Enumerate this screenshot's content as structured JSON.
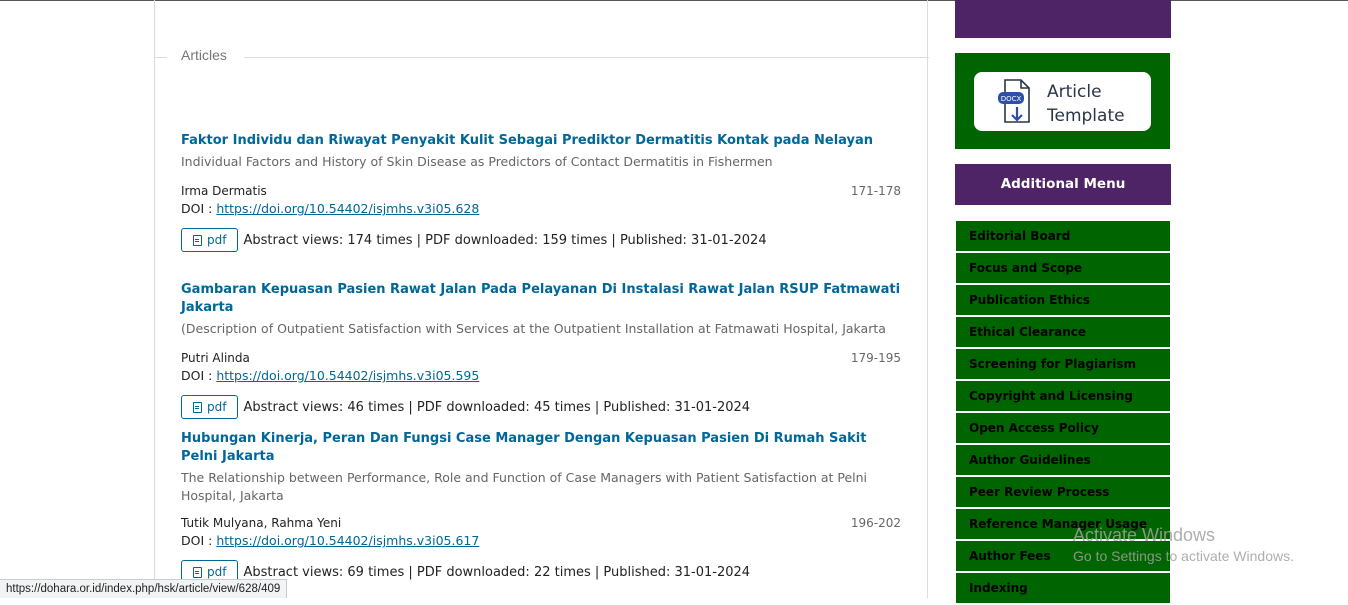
{
  "section": {
    "heading": "Articles"
  },
  "articles": [
    {
      "title": "Faktor Individu dan Riwayat Penyakit Kulit Sebagai Prediktor Dermatitis Kontak pada Nelayan",
      "subtitle": "Individual Factors and History of Skin Disease as Predictors of Contact Dermatitis in Fishermen",
      "authors": "Irma Dermatis",
      "pages": "171-178",
      "doi_label": "DOI : ",
      "doi": "https://doi.org/10.54402/isjmhs.v3i05.628",
      "pdf_label": "pdf",
      "stats": "Abstract views: 174 times | PDF downloaded: 159 times | Published: 31-01-2024"
    },
    {
      "title": "Gambaran Kepuasan Pasien Rawat Jalan Pada Pelayanan Di Instalasi Rawat Jalan RSUP Fatmawati Jakarta",
      "subtitle": "(Description of Outpatient Satisfaction with Services at the Outpatient Installation at Fatmawati Hospital, Jakarta",
      "authors": "Putri Alinda",
      "pages": "179-195",
      "doi_label": "DOI : ",
      "doi": "https://doi.org/10.54402/isjmhs.v3i05.595",
      "pdf_label": "pdf",
      "stats": "Abstract views: 46 times | PDF downloaded: 45 times | Published: 31-01-2024"
    },
    {
      "title": "Hubungan Kinerja, Peran Dan Fungsi Case Manager Dengan Kepuasan Pasien Di Rumah Sakit Pelni Jakarta",
      "subtitle": "The Relationship between Performance, Role and Function of Case Managers with Patient Satisfaction at Pelni Hospital, Jakarta",
      "authors": "Tutik Mulyana, Rahma Yeni",
      "pages": "196-202",
      "doi_label": "DOI : ",
      "doi": "https://doi.org/10.54402/isjmhs.v3i05.617",
      "pdf_label": "pdf",
      "stats": "Abstract views: 69 times | PDF downloaded: 22 times | Published: 31-01-2024"
    }
  ],
  "sidebar": {
    "template": {
      "badge": "DOCX",
      "line1": "Article",
      "line2": "Template"
    },
    "menu_heading": "Additional Menu",
    "menu": [
      "Editorial Board",
      "Focus and Scope",
      "Publication Ethics",
      "Ethical Clearance",
      "Screening for Plagiarism",
      "Copyright and Licensing",
      "Open Access Policy",
      "Author Guidelines",
      "Peer Review Process",
      "Reference Manager Usage",
      "Author Fees",
      "Indexing"
    ]
  },
  "watermark": {
    "line1": "Activate Windows",
    "line2": "Go to Settings to activate Windows."
  },
  "status_bar": {
    "url": "https://dohara.or.id/index.php/hsk/article/view/628/409"
  },
  "colors": {
    "link": "#006798",
    "sidebar_green": "#006400",
    "sidebar_purple": "#4f2466"
  }
}
